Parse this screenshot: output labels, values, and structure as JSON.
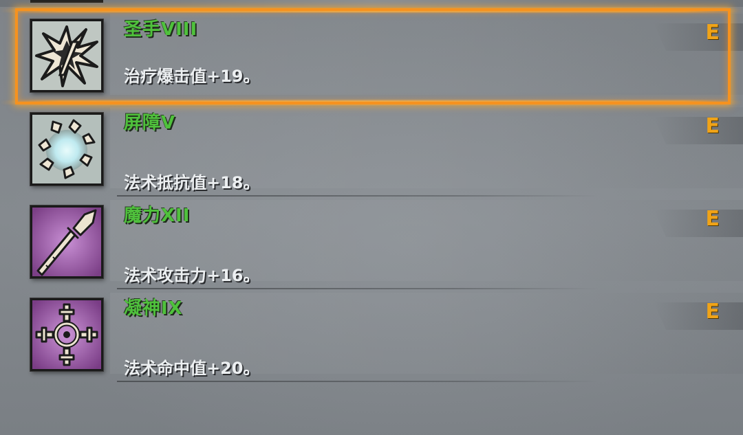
{
  "colors": {
    "name_green": "#4fc13c",
    "grade_orange": "#f0a317",
    "selection_orange": "#f6921f",
    "description_white": "#eceff1"
  },
  "selected_index": 0,
  "skills": [
    {
      "name": "圣手VIII",
      "description": "治疗爆击值+19。",
      "grade": "E",
      "icon": "starburst-icon",
      "icon_theme": "pale"
    },
    {
      "name": "屏障V",
      "description": "法术抵抗值+18。",
      "grade": "E",
      "icon": "barrier-shatter-icon",
      "icon_theme": "pale"
    },
    {
      "name": "魔力XII",
      "description": "法术攻击力+16。",
      "grade": "E",
      "icon": "magic-spear-icon",
      "icon_theme": "purple"
    },
    {
      "name": "凝神IX",
      "description": "法术命中值+20。",
      "grade": "E",
      "icon": "crosshair-icon",
      "icon_theme": "purple"
    }
  ]
}
